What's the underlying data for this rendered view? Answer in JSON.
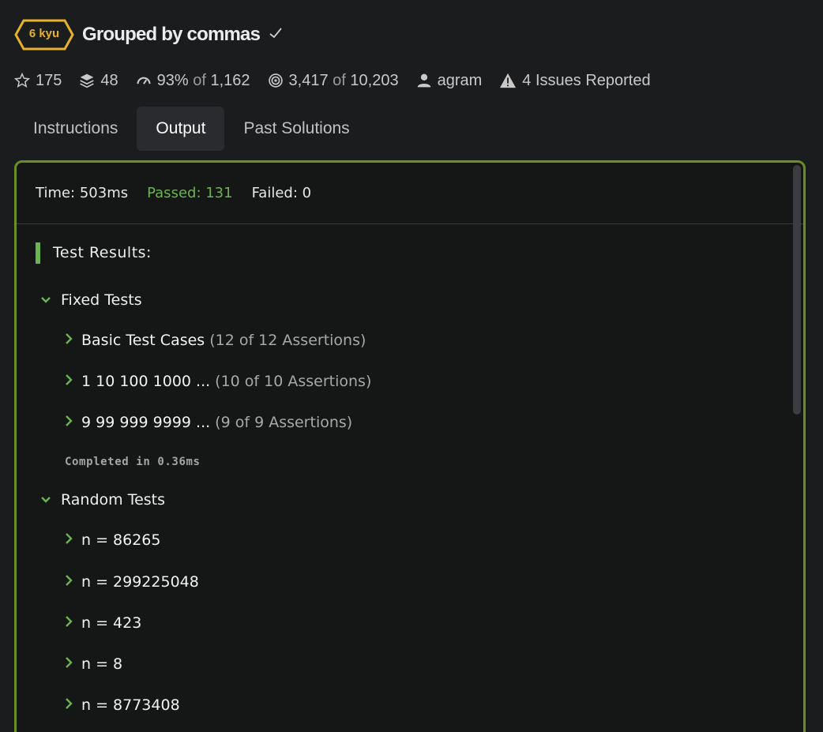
{
  "kata": {
    "rank": "6 kyu",
    "title": "Grouped by commas",
    "rank_color": "#e7b129"
  },
  "stats": {
    "stars": "175",
    "collections": "48",
    "satisfaction": "93%",
    "satisfaction_of": "of",
    "votes": "1,162",
    "completed": "3,417",
    "completed_of": "of",
    "attempts": "10,203",
    "author": "agram",
    "issues": "4 Issues Reported"
  },
  "tabs": [
    {
      "label": "Instructions",
      "active": false
    },
    {
      "label": "Output",
      "active": true
    },
    {
      "label": "Past Solutions",
      "active": false
    }
  ],
  "output": {
    "time": "Time: 503ms",
    "passed": "Passed: 131",
    "failed": "Failed: 0",
    "results_title": "Test Results:",
    "accent": "#6cb352",
    "border": "#6b8e23",
    "groups": [
      {
        "title": "Fixed Tests",
        "items": [
          {
            "label": "Basic Test Cases",
            "assertions": "(12 of 12 Assertions)"
          },
          {
            "label": "1 10 100 1000 ...",
            "assertions": "(10 of 10 Assertions)"
          },
          {
            "label": "9 99 999 9999 ...",
            "assertions": "(9 of 9 Assertions)"
          }
        ],
        "completed": "Completed in 0.36ms"
      },
      {
        "title": "Random Tests",
        "items": [
          {
            "label": "n = 86265"
          },
          {
            "label": "n = 299225048"
          },
          {
            "label": "n = 423"
          },
          {
            "label": "n = 8"
          },
          {
            "label": "n = 8773408"
          }
        ]
      }
    ]
  }
}
